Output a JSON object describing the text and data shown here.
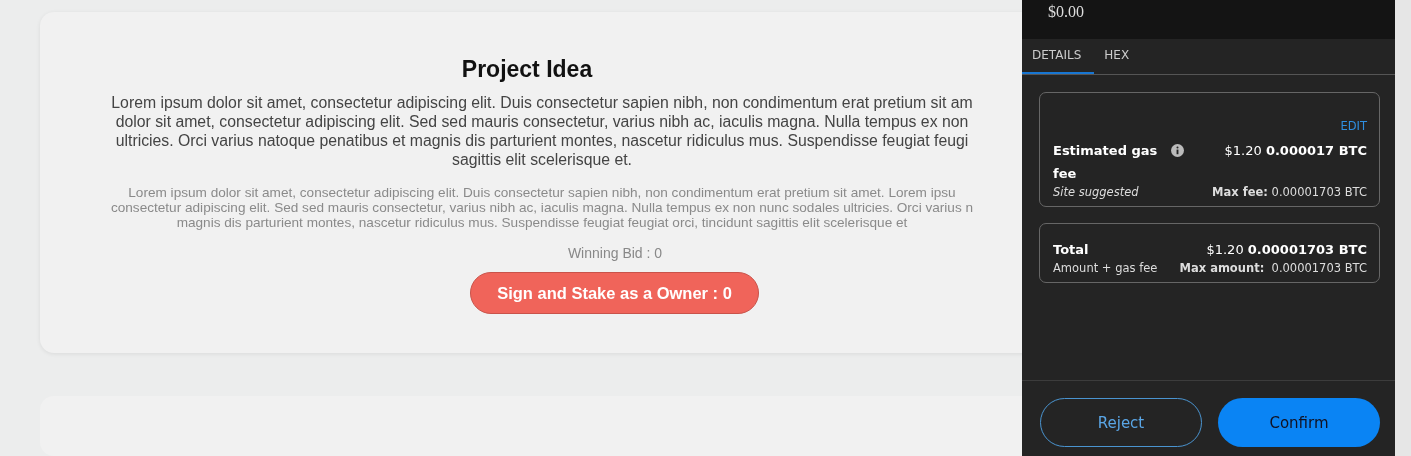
{
  "card": {
    "title": "Project Idea",
    "paragraph_lines": [
      "Lorem ipsum dolor sit amet, consectetur adipiscing elit. Duis consectetur sapien nibh, non condimentum erat pretium sit am",
      "dolor sit amet, consectetur adipiscing elit. Sed sed mauris consectetur, varius nibh ac, iaculis magna. Nulla tempus ex non",
      "ultricies. Orci varius natoque penatibus et magnis dis parturient montes, nascetur ridiculus mus. Suspendisse feugiat feugi",
      "sagittis elit scelerisque et."
    ],
    "secondary_lines": [
      "Lorem ipsum dolor sit amet, consectetur adipiscing elit. Duis consectetur sapien nibh, non condimentum erat pretium sit amet. Lorem ipsu",
      "consectetur adipiscing elit. Sed sed mauris consectetur, varius nibh ac, iaculis magna. Nulla tempus ex non nunc sodales ultricies. Orci varius n",
      "magnis dis parturient montes, nascetur ridiculus mus. Suspendisse feugiat feugiat orci, tincidunt sagittis elit scelerisque et"
    ],
    "winning_bid": "Winning Bid : 0",
    "button": "Sign and Stake as a Owner : 0"
  },
  "wallet": {
    "amount": "$0.00",
    "tabs": [
      {
        "label": "DETAILS",
        "selected": true
      },
      {
        "label": "HEX",
        "selected": false
      }
    ],
    "edit": "EDIT",
    "gas": {
      "label": "Estimated gas fee",
      "fiat": "$1.20",
      "crypto": "0.000017 BTC",
      "note": "Site suggested",
      "max_label": "Max fee:",
      "max_value": "0.00001703 BTC"
    },
    "total": {
      "label": "Total",
      "fiat": "$1.20",
      "crypto": "0.00001703 BTC",
      "note": "Amount + gas fee",
      "max_label": "Max amount:",
      "max_value": "0.00001703 BTC"
    },
    "buttons": {
      "reject": "Reject",
      "confirm": "Confirm"
    }
  }
}
